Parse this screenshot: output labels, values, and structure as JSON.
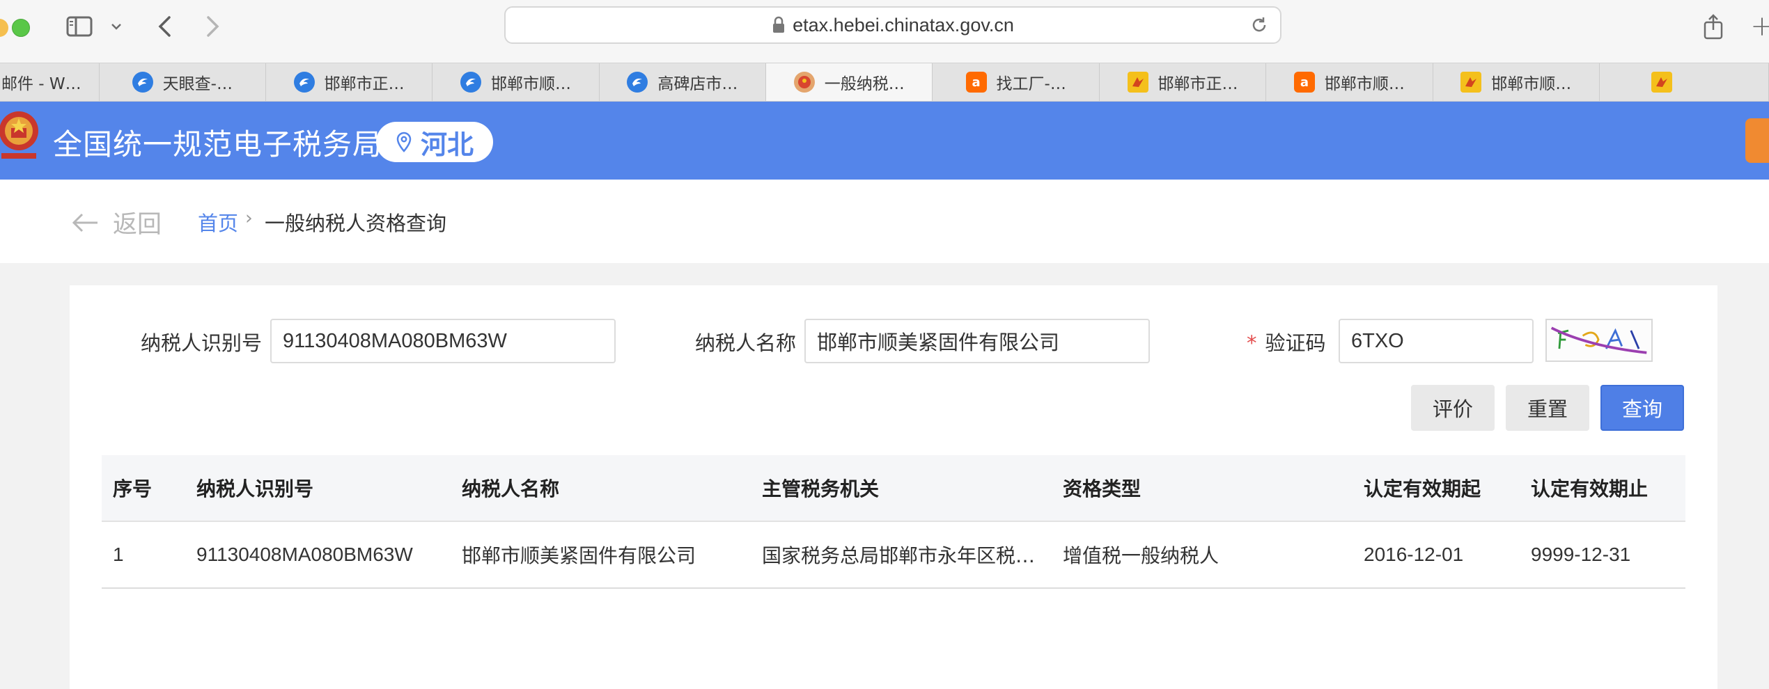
{
  "browser": {
    "url": "etax.hebei.chinatax.gov.cn",
    "tabs": [
      {
        "label": "邮件 - W…",
        "icon": "partial-tab",
        "active": false
      },
      {
        "label": "天眼查-…",
        "icon": "tianyancha-eagle-icon",
        "active": false
      },
      {
        "label": "邯郸市正…",
        "icon": "tianyancha-eagle-icon",
        "active": false
      },
      {
        "label": "邯郸市顺…",
        "icon": "tianyancha-eagle-icon",
        "active": false
      },
      {
        "label": "高碑店市…",
        "icon": "tianyancha-eagle-icon",
        "active": false
      },
      {
        "label": "一般纳税…",
        "icon": "tax-emblem-icon",
        "active": true
      },
      {
        "label": "找工厂-…",
        "icon": "alibaba-icon",
        "active": false
      },
      {
        "label": "邯郸市正…",
        "icon": "yellow-logo-icon",
        "active": false
      },
      {
        "label": "邯郸市顺…",
        "icon": "alibaba-icon",
        "active": false
      },
      {
        "label": "邯郸市顺…",
        "icon": "yellow-logo-icon",
        "active": false
      },
      {
        "label": "",
        "icon": "yellow-logo-icon",
        "active": false
      }
    ]
  },
  "header": {
    "title": "全国统一规范电子税务局",
    "region": "河北",
    "brand_color": "#5485ea"
  },
  "breadcrumb": {
    "back": "返回",
    "home": "首页",
    "separator": "›",
    "current": "一般纳税人资格查询"
  },
  "form": {
    "taxpayer_id_label": "纳税人识别号",
    "taxpayer_id_value": "91130408MA080BM63W",
    "taxpayer_name_label": "纳税人名称",
    "taxpayer_name_value": "邯郸市顺美紧固件有限公司",
    "captcha_required_mark": "*",
    "captcha_label": "验证码",
    "captcha_value": "6TXO",
    "buttons": {
      "evaluate": "评价",
      "reset": "重置",
      "search": "查询"
    }
  },
  "table": {
    "columns": [
      "序号",
      "纳税人识别号",
      "纳税人名称",
      "主管税务机关",
      "资格类型",
      "认定有效期起",
      "认定有效期止"
    ],
    "rows": [
      [
        "1",
        "91130408MA080BM63W",
        "邯郸市顺美紧固件有限公司",
        "国家税务总局邯郸市永年区税…",
        "增值税一般纳税人",
        "2016-12-01",
        "9999-12-31"
      ]
    ]
  }
}
